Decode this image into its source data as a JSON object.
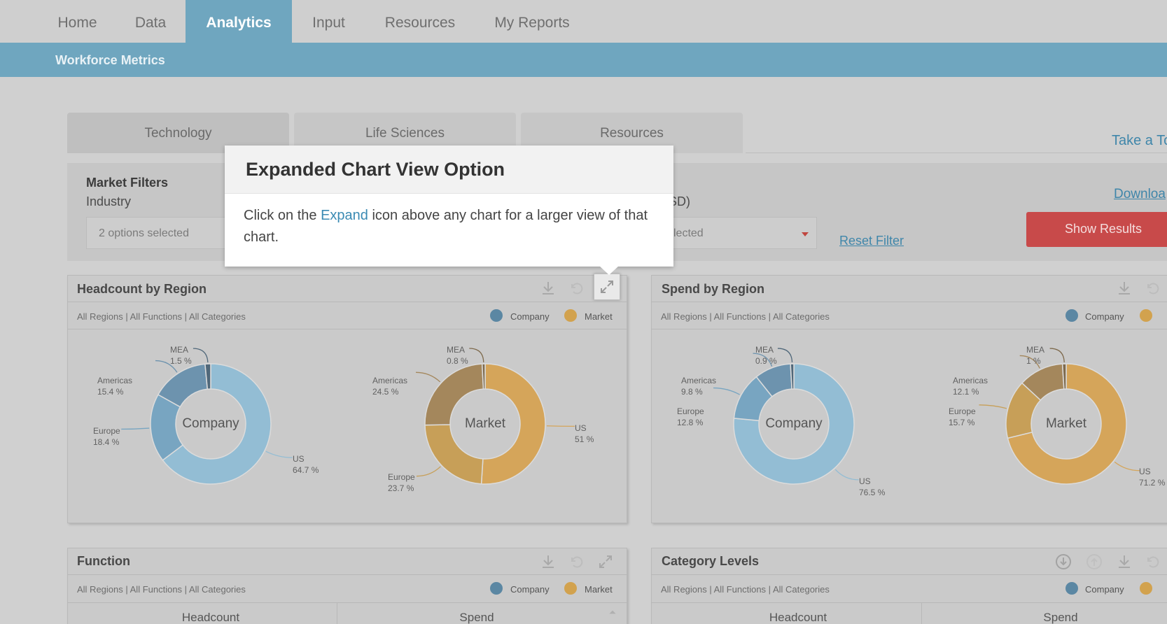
{
  "nav": {
    "tabs": [
      "Home",
      "Data",
      "Analytics",
      "Input",
      "Resources",
      "My Reports"
    ],
    "active": "Analytics"
  },
  "subnav": {
    "title": "Workforce Metrics"
  },
  "industry_tabs": [
    "Technology",
    "Life Sciences",
    "Resources"
  ],
  "take_tour": "Take a To",
  "filters": {
    "title": "Market Filters",
    "industry_label": "Industry",
    "industry_value": "2 options selected",
    "second_label": "SD)",
    "second_value": "lected",
    "reset": "Reset Filter",
    "download": "Downloa",
    "show_results": "Show Results"
  },
  "popover": {
    "title": "Expanded Chart View Option",
    "body_before": "Click on the ",
    "body_link": "Expand",
    "body_after": " icon above any chart for a larger view of that chart."
  },
  "cards": {
    "headcount": {
      "title": "Headcount by Region",
      "sub": "All Regions | All Functions | All Categories",
      "legend": [
        "Company",
        "Market"
      ]
    },
    "spend": {
      "title": "Spend by Region",
      "sub": "All Regions | All Functions | All Categories",
      "legend": [
        "Company"
      ]
    },
    "function": {
      "title": "Function",
      "sub": "All Regions | All Functions | All Categories",
      "legend": [
        "Company",
        "Market"
      ],
      "columns": [
        "Headcount",
        "Spend"
      ]
    },
    "category": {
      "title": "Category Levels",
      "sub": "All Regions | All Functions | All Categories",
      "legend": [
        "Company"
      ],
      "columns": [
        "Headcount",
        "Spend"
      ]
    }
  },
  "colors": {
    "company": "#5b87a3",
    "market": "#d2a24e",
    "accent": "#6fa6bf",
    "show_button": "#c84a4a"
  },
  "chart_data": [
    {
      "type": "pie",
      "title": "Company",
      "categories": [
        "US",
        "Europe",
        "Americas",
        "MEA"
      ],
      "values": [
        64.7,
        18.4,
        15.4,
        1.5
      ],
      "labels": [
        "US\n64.7 %",
        "Europe\n18.4 %",
        "Americas\n15.4 %",
        "MEA\n1.5 %"
      ]
    },
    {
      "type": "pie",
      "title": "Market",
      "categories": [
        "US",
        "Europe",
        "Americas",
        "MEA"
      ],
      "values": [
        51.0,
        23.7,
        24.5,
        0.8
      ],
      "labels": [
        "US\n51.0 %",
        "Europe\n23.7 %",
        "Americas\n24.5 %",
        "MEA\n0.8 %"
      ]
    },
    {
      "type": "pie",
      "title": "Company",
      "categories": [
        "US",
        "Europe",
        "Americas",
        "MEA"
      ],
      "values": [
        76.5,
        12.8,
        9.8,
        0.9
      ],
      "labels": [
        "US\n76.5 %",
        "Europe\n12.8 %",
        "Americas\n9.8 %",
        "MEA\n0.9 %"
      ]
    },
    {
      "type": "pie",
      "title": "Market",
      "categories": [
        "US",
        "Europe",
        "Americas",
        "MEA"
      ],
      "values": [
        71.2,
        15.7,
        12.1,
        1.0
      ],
      "labels": [
        "US\n71.2 %",
        "Europe\n15.7 %",
        "Americas\n12.1 %",
        "MEA\n1.0 %"
      ]
    }
  ]
}
